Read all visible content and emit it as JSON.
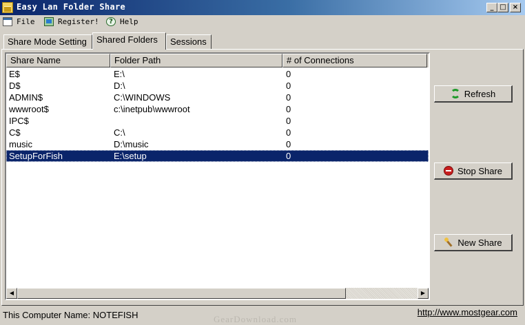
{
  "window": {
    "title": "Easy Lan Folder Share",
    "minimize_glyph": "_",
    "maximize_glyph": "□",
    "close_glyph": "×"
  },
  "menu": {
    "file": "File",
    "register": "Register!",
    "help": "Help"
  },
  "tabs": [
    {
      "label": "Share Mode Setting",
      "active": false
    },
    {
      "label": "Shared Folders",
      "active": true
    },
    {
      "label": "Sessions",
      "active": false
    }
  ],
  "table": {
    "columns": [
      "Share Name",
      "Folder Path",
      "# of Connections"
    ],
    "rows": [
      {
        "name": "E$",
        "path": "E:\\",
        "connections": "0"
      },
      {
        "name": "D$",
        "path": "D:\\",
        "connections": "0"
      },
      {
        "name": "ADMIN$",
        "path": "C:\\WINDOWS",
        "connections": "0"
      },
      {
        "name": "wwwroot$",
        "path": "c:\\inetpub\\wwwroot",
        "connections": "0"
      },
      {
        "name": "IPC$",
        "path": "",
        "connections": "0"
      },
      {
        "name": "C$",
        "path": "C:\\",
        "connections": "0"
      },
      {
        "name": "music",
        "path": "D:\\music",
        "connections": "0"
      },
      {
        "name": "SetupForFish",
        "path": "E:\\setup",
        "connections": "0",
        "selected": true
      }
    ],
    "scroll_left_glyph": "◀",
    "scroll_right_glyph": "▶"
  },
  "buttons": {
    "refresh": "Refresh",
    "stop_share": "Stop Share",
    "new_share": "New Share"
  },
  "status": {
    "computer_name": "This Computer Name: NOTEFISH",
    "link": "http://www.mostgear.com"
  },
  "watermark": "GearDownload.com",
  "colors": {
    "titlebar_start": "#0a246a",
    "selection": "#0a246a",
    "window_bg": "#d4d0c8"
  }
}
